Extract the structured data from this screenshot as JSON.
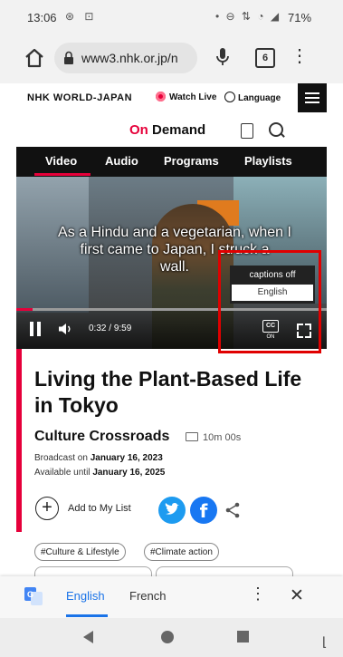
{
  "status_bar": {
    "time": "13:06",
    "battery": "71%"
  },
  "browser": {
    "url": "www3.nhk.or.jp/n",
    "tab_count": "6"
  },
  "site_header": {
    "logo": "NHK WORLD-JAPAN",
    "watch_live": "Watch Live",
    "language": "Language"
  },
  "ondemand": {
    "prefix": "On",
    "suffix": " Demand"
  },
  "nav_tabs": [
    {
      "label": "Video",
      "active": true
    },
    {
      "label": "Audio",
      "active": false
    },
    {
      "label": "Programs",
      "active": false
    },
    {
      "label": "Playlists",
      "active": false
    }
  ],
  "player": {
    "caption_line1": "As a Hindu and a vegetarian, when I",
    "caption_line2": "first came to Japan, I struck a",
    "caption_line3": "wall.",
    "current_time": "0:32",
    "duration": "9:59",
    "progress": 0.053,
    "cc_label": "CC",
    "cc_state": "ON",
    "captions_menu": {
      "off_label": "captions off",
      "english_label": "English"
    }
  },
  "article": {
    "title": "Living the Plant-Based Life in Tokyo",
    "program": "Culture Crossroads",
    "length": "10m 00s",
    "broadcast_prefix": "Broadcast on ",
    "broadcast_date": "January 16, 2023",
    "available_prefix": "Available until ",
    "available_date": "January 16, 2025",
    "add_to_list": "Add to My List",
    "tags": [
      "#Culture & Lifestyle",
      "#Climate action"
    ]
  },
  "translate_bar": {
    "source_lang": "English",
    "target_lang": "French"
  },
  "colors": {
    "nhk_red": "#e6003a",
    "highlight_red": "#e00000",
    "google_blue": "#1a73e8",
    "twitter_blue": "#1d9bf0",
    "facebook_blue": "#1877f2"
  }
}
